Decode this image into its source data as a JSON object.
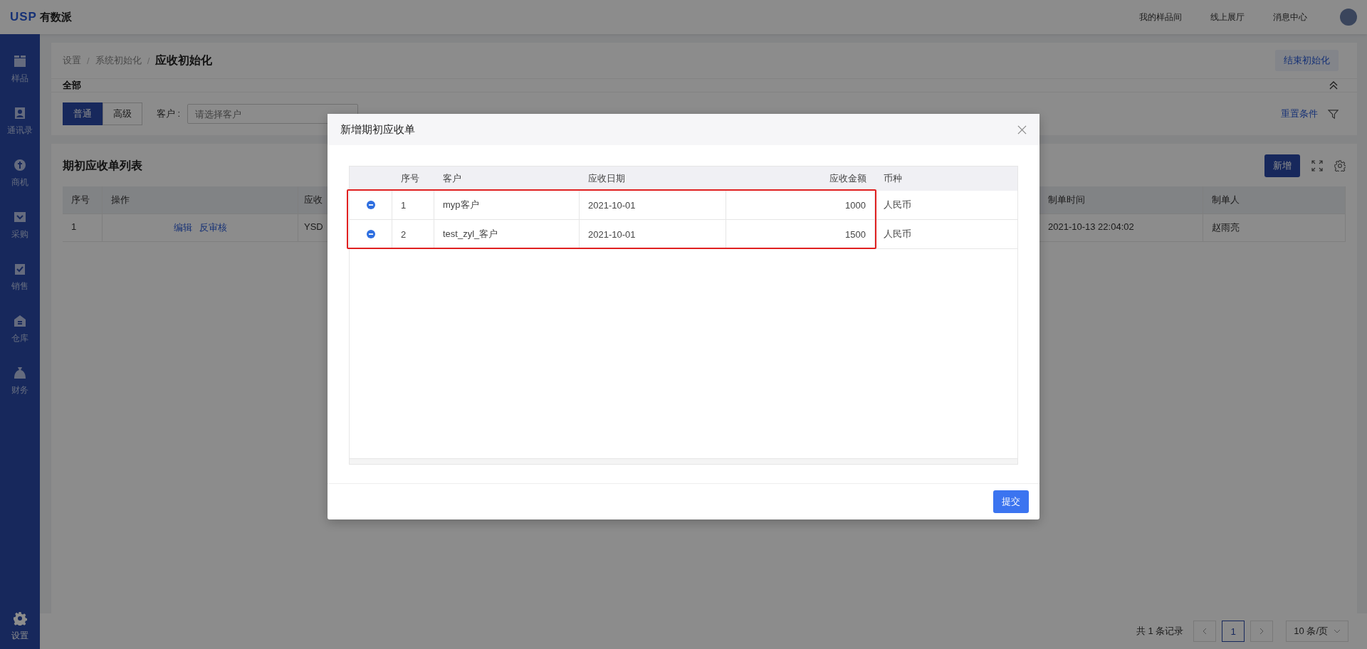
{
  "header": {
    "logo_mark": "USP",
    "logo_text": "有数派",
    "links": [
      "我的样品间",
      "线上展厅",
      "消息中心"
    ]
  },
  "sidebar": {
    "items": [
      {
        "label": "样品",
        "selected": false
      },
      {
        "label": "通讯录",
        "selected": false
      },
      {
        "label": "商机",
        "selected": false
      },
      {
        "label": "采购",
        "selected": false
      },
      {
        "label": "销售",
        "selected": false
      },
      {
        "label": "仓库",
        "selected": false
      },
      {
        "label": "财务",
        "selected": false
      }
    ],
    "bottom_item": {
      "label": "设置",
      "selected": true
    }
  },
  "breadcrumb": [
    {
      "kind": "link",
      "label": "设置"
    },
    {
      "kind": "separator",
      "label": "/"
    },
    {
      "kind": "link",
      "label": "系统初始化"
    },
    {
      "kind": "separator",
      "label": "/"
    },
    {
      "kind": "current",
      "label": "应收初始化"
    }
  ],
  "end_button": "结束初始化",
  "tabs": [
    {
      "label": "全部",
      "selected": true
    }
  ],
  "filter": {
    "modes": [
      {
        "label": "普通",
        "selected": true
      },
      {
        "label": "高级",
        "selected": false
      }
    ],
    "customer_label": "客户 :",
    "customer_placeholder": "请选择客户",
    "reset": "重置条件"
  },
  "list": {
    "title": "期初应收单列表",
    "add_button": "新增",
    "columns": [
      "序号",
      "操作",
      "应收",
      "制单时间",
      "制单人"
    ],
    "rows": [
      {
        "index": "1",
        "actions": [
          "编辑",
          "反审核"
        ],
        "column_3": "YSD",
        "created": "2021-10-13 22:04:02",
        "creator": "赵雨亮"
      }
    ]
  },
  "pagination": {
    "total": "共 1 条记录",
    "pages": [
      {
        "label": "1",
        "selected": true
      }
    ],
    "page_size": "10 条/页"
  },
  "modal": {
    "title": "新增期初应收单",
    "columns": [
      "序号",
      "客户",
      "应收日期",
      "应收金额",
      "币种"
    ],
    "rows": [
      {
        "index": "1",
        "customer": "myp客户",
        "date": "2021-10-01",
        "amount": "1000",
        "currency": "人民币",
        "highlighted": true
      },
      {
        "index": "2",
        "customer": "test_zyl_客户",
        "date": "2021-10-01",
        "amount": "1500",
        "currency": "人民币",
        "highlighted": true
      }
    ],
    "submit": "提交"
  }
}
